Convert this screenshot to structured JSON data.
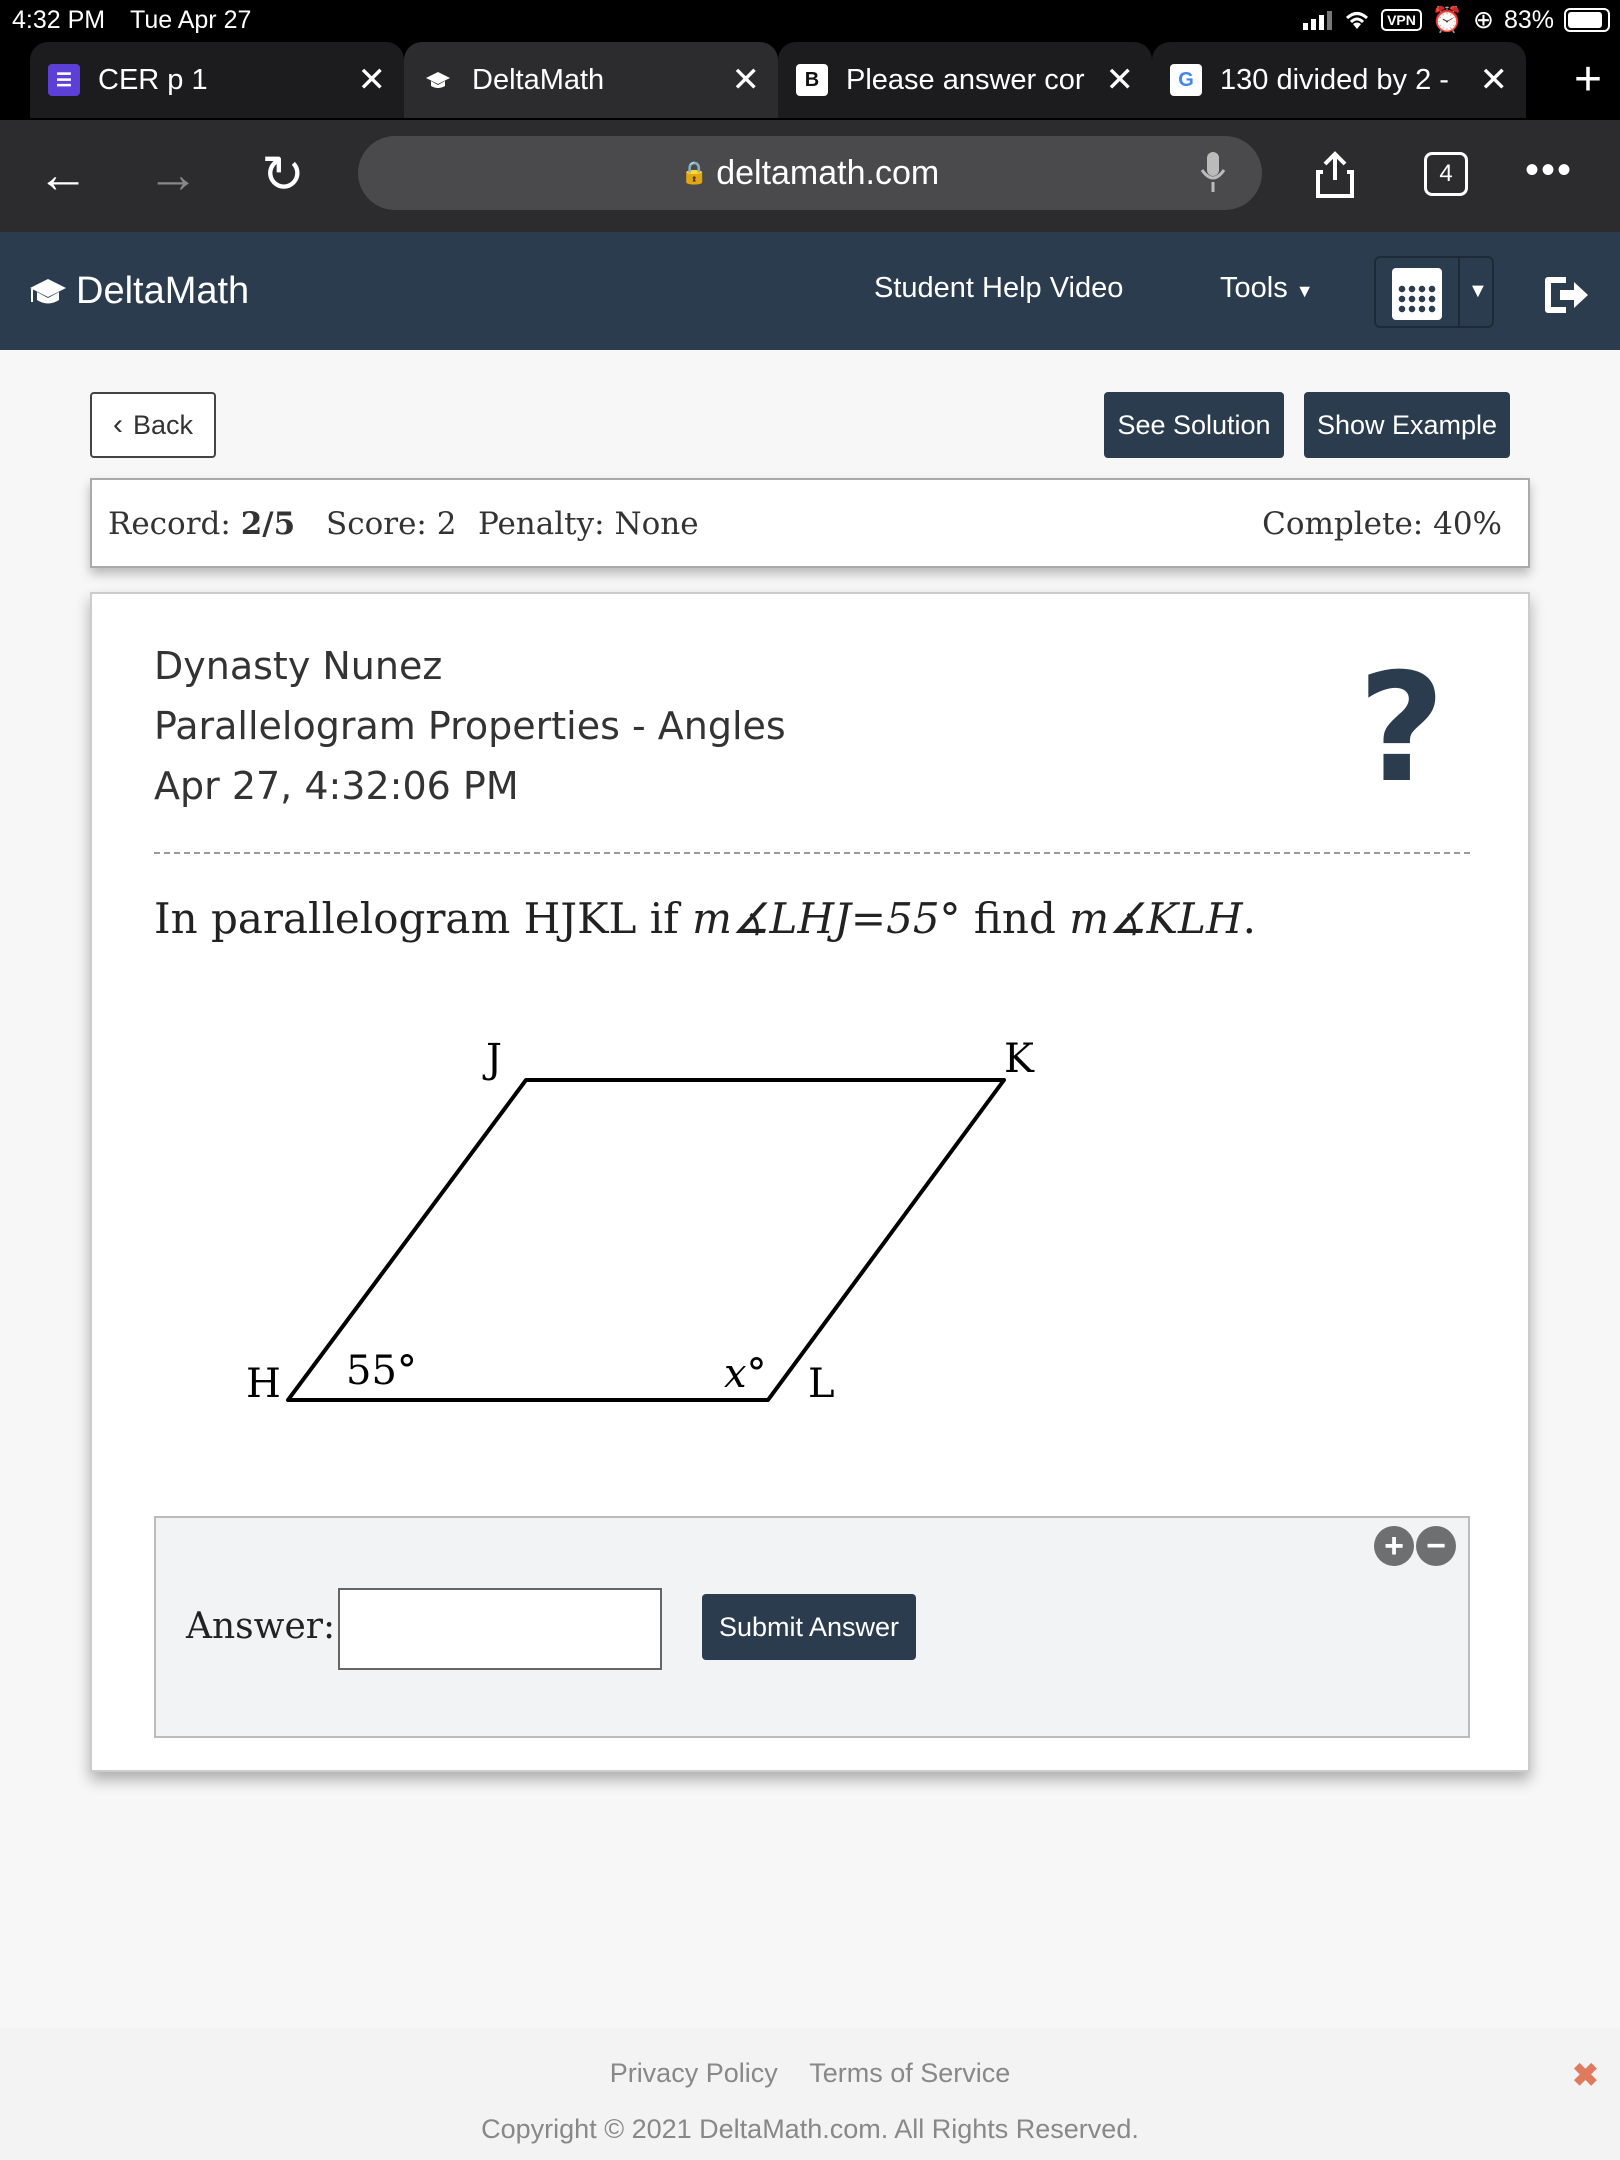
{
  "status_bar": {
    "time": "4:32 PM",
    "date": "Tue Apr 27",
    "vpn": "VPN",
    "battery": "83%"
  },
  "tabs": [
    {
      "label": "CER p 1",
      "icon": "list-icon",
      "color": "#5b3fd6"
    },
    {
      "label": "DeltaMath",
      "icon": "graduation-cap-icon",
      "active": true
    },
    {
      "label": "Please answer cor",
      "icon": "b-icon",
      "color": "#1e1e1e"
    },
    {
      "label": "130 divided by 2 -",
      "icon": "google-icon",
      "color": "#ffffff"
    }
  ],
  "browser": {
    "url": "deltamath.com",
    "tab_count": "4"
  },
  "app": {
    "brand": "DeltaMath",
    "nav": {
      "help_video": "Student Help Video",
      "tools": "Tools"
    }
  },
  "buttons": {
    "back": "Back",
    "see_solution": "See Solution",
    "show_example": "Show Example",
    "submit": "Submit Answer"
  },
  "record": {
    "record_label": "Record:",
    "record_value": "2/5",
    "score": "Score: 2",
    "penalty": "Penalty: None",
    "complete": "Complete: 40%"
  },
  "problem": {
    "student": "Dynasty Nunez",
    "topic": "Parallelogram Properties - Angles",
    "timestamp": "Apr 27, 4:32:06 PM",
    "question_prefix": "In parallelogram HJKL if ",
    "given_angle": "m∡LHJ=55°",
    "question_mid": " find ",
    "find_angle": "m∡KLH",
    "question_suffix": ".",
    "help_mark": "?"
  },
  "diagram": {
    "vertices": {
      "H": "H",
      "J": "J",
      "K": "K",
      "L": "L"
    },
    "angle_H": "55°",
    "angle_L": "x°"
  },
  "answer": {
    "label": "Answer:",
    "value": ""
  },
  "footer": {
    "privacy": "Privacy Policy",
    "terms": "Terms of Service",
    "copyright": "Copyright © 2021 DeltaMath.com. All Rights Reserved."
  }
}
